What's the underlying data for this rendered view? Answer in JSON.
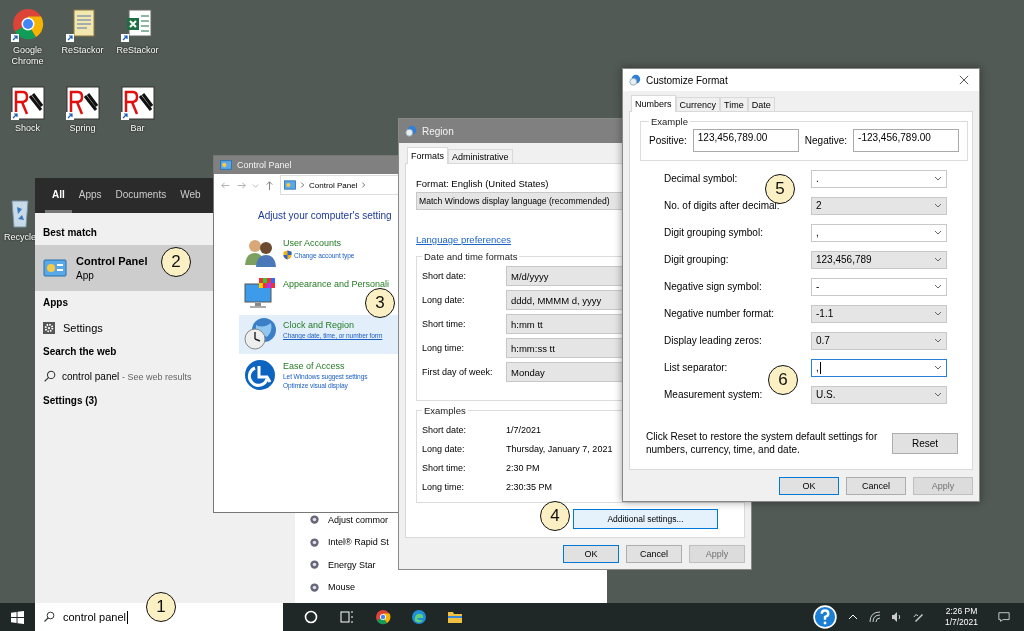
{
  "desktop_icons": [
    {
      "label": "Google Chrome",
      "kind": "chrome"
    },
    {
      "label": "ReStackor",
      "kind": "document"
    },
    {
      "label": "ReStackor",
      "kind": "sheet"
    },
    {
      "label": "Shock",
      "kind": "sketch"
    },
    {
      "label": "Spring",
      "kind": "sketch"
    },
    {
      "label": "Bar",
      "kind": "sketch"
    }
  ],
  "recycle_bin": {
    "label": "Recycle"
  },
  "start_menu": {
    "tabs": [
      {
        "label": "All",
        "selected": true
      },
      {
        "label": "Apps",
        "selected": false
      },
      {
        "label": "Documents",
        "selected": false
      },
      {
        "label": "Web",
        "selected": false
      }
    ],
    "best_match_heading": "Best match",
    "best_match": {
      "title": "Control Panel",
      "subtitle": "App",
      "selected": true
    },
    "apps_heading": "Apps",
    "apps": [
      {
        "label": "Settings"
      }
    ],
    "web_heading": "Search the web",
    "web_result": {
      "query": "control panel",
      "hint": "- See web results"
    },
    "settings_heading": "Settings (3)",
    "preview_items": [
      "Adjust commor",
      "Intel® Rapid St",
      "Energy Star",
      "Mouse"
    ]
  },
  "control_panel": {
    "title": "Control Panel",
    "breadcrumb": "Control Panel",
    "heading": "Adjust your computer's setting",
    "categories": [
      {
        "title": "User Accounts",
        "kind": "users",
        "selected": false,
        "links": [
          {
            "label": "Change account type",
            "shield": true
          }
        ]
      },
      {
        "title": "Appearance and Personali",
        "kind": "appearance",
        "selected": false
      },
      {
        "title": "Clock and Region",
        "kind": "clock",
        "selected": true,
        "links": [
          {
            "label": "Change date, time, or number form",
            "shield": false
          }
        ]
      },
      {
        "title": "Ease of Access",
        "kind": "access",
        "selected": false,
        "links": [
          {
            "label": "Let Windows suggest settings",
            "shield": false
          },
          {
            "label": "Optimize visual display",
            "shield": false
          }
        ]
      }
    ]
  },
  "region": {
    "title": "Region",
    "tabs": [
      {
        "label": "Formats",
        "selected": true
      },
      {
        "label": "Administrative",
        "selected": false
      }
    ],
    "format_label": "Format: English (United States)",
    "format_value": "Match Windows display language (recommended)",
    "link": "Language preferences",
    "formats_title": "Date and time formats",
    "formats": [
      {
        "label": "Short date:",
        "value": "M/d/yyyy"
      },
      {
        "label": "Long date:",
        "value": "dddd, MMMM d, yyyy"
      },
      {
        "label": "Short time:",
        "value": "h:mm tt"
      },
      {
        "label": "Long time:",
        "value": "h:mm:ss tt"
      },
      {
        "label": "First day of week:",
        "value": "Monday"
      }
    ],
    "examples_title": "Examples",
    "examples": [
      {
        "label": "Short date:",
        "value": "1/7/2021"
      },
      {
        "label": "Long date:",
        "value": "Thursday, January 7, 2021"
      },
      {
        "label": "Short time:",
        "value": "2:30 PM"
      },
      {
        "label": "Long time:",
        "value": "2:30:35 PM"
      }
    ],
    "additional_button": "Additional settings...",
    "buttons": [
      {
        "label": "OK",
        "default": true,
        "disabled": false
      },
      {
        "label": "Cancel",
        "default": false,
        "disabled": false
      },
      {
        "label": "Apply",
        "default": false,
        "disabled": true
      }
    ]
  },
  "customize": {
    "title": "Customize Format",
    "tabs": [
      {
        "label": "Numbers",
        "selected": true
      },
      {
        "label": "Currency",
        "selected": false
      },
      {
        "label": "Time",
        "selected": false
      },
      {
        "label": "Date",
        "selected": false
      }
    ],
    "example_title": "Example",
    "positive_label": "Positive:",
    "positive": "123,456,789.00",
    "negative_label": "Negative:",
    "negative": "-123,456,789.00",
    "settings": [
      {
        "label": "Decimal symbol:",
        "value": ".",
        "kind": "editable",
        "focused": false
      },
      {
        "label": "No. of digits after decimal:",
        "value": "2",
        "kind": "list",
        "focused": false
      },
      {
        "label": "Digit grouping symbol:",
        "value": ",",
        "kind": "editable",
        "focused": false
      },
      {
        "label": "Digit grouping:",
        "value": "123,456,789",
        "kind": "list",
        "focused": false
      },
      {
        "label": "Negative sign symbol:",
        "value": "-",
        "kind": "editable",
        "focused": false
      },
      {
        "label": "Negative number format:",
        "value": "-1.1",
        "kind": "list",
        "focused": false
      },
      {
        "label": "Display leading zeros:",
        "value": "0.7",
        "kind": "list",
        "focused": false
      },
      {
        "label": "List separator:",
        "value": ",",
        "kind": "editable",
        "focused": true
      },
      {
        "label": "Measurement system:",
        "value": "U.S.",
        "kind": "list",
        "focused": false
      }
    ],
    "note": "Click Reset to restore the system default settings for numbers, currency, time, and date.",
    "reset": "Reset",
    "buttons": [
      {
        "label": "OK",
        "default": true,
        "disabled": false
      },
      {
        "label": "Cancel",
        "default": false,
        "disabled": false
      },
      {
        "label": "Apply",
        "default": false,
        "disabled": true
      }
    ]
  },
  "step_markers": [
    "1",
    "2",
    "3",
    "4",
    "5",
    "6"
  ],
  "taskbar": {
    "search_value": "control panel",
    "time": "2:26 PM",
    "date": "1/7/2021"
  }
}
